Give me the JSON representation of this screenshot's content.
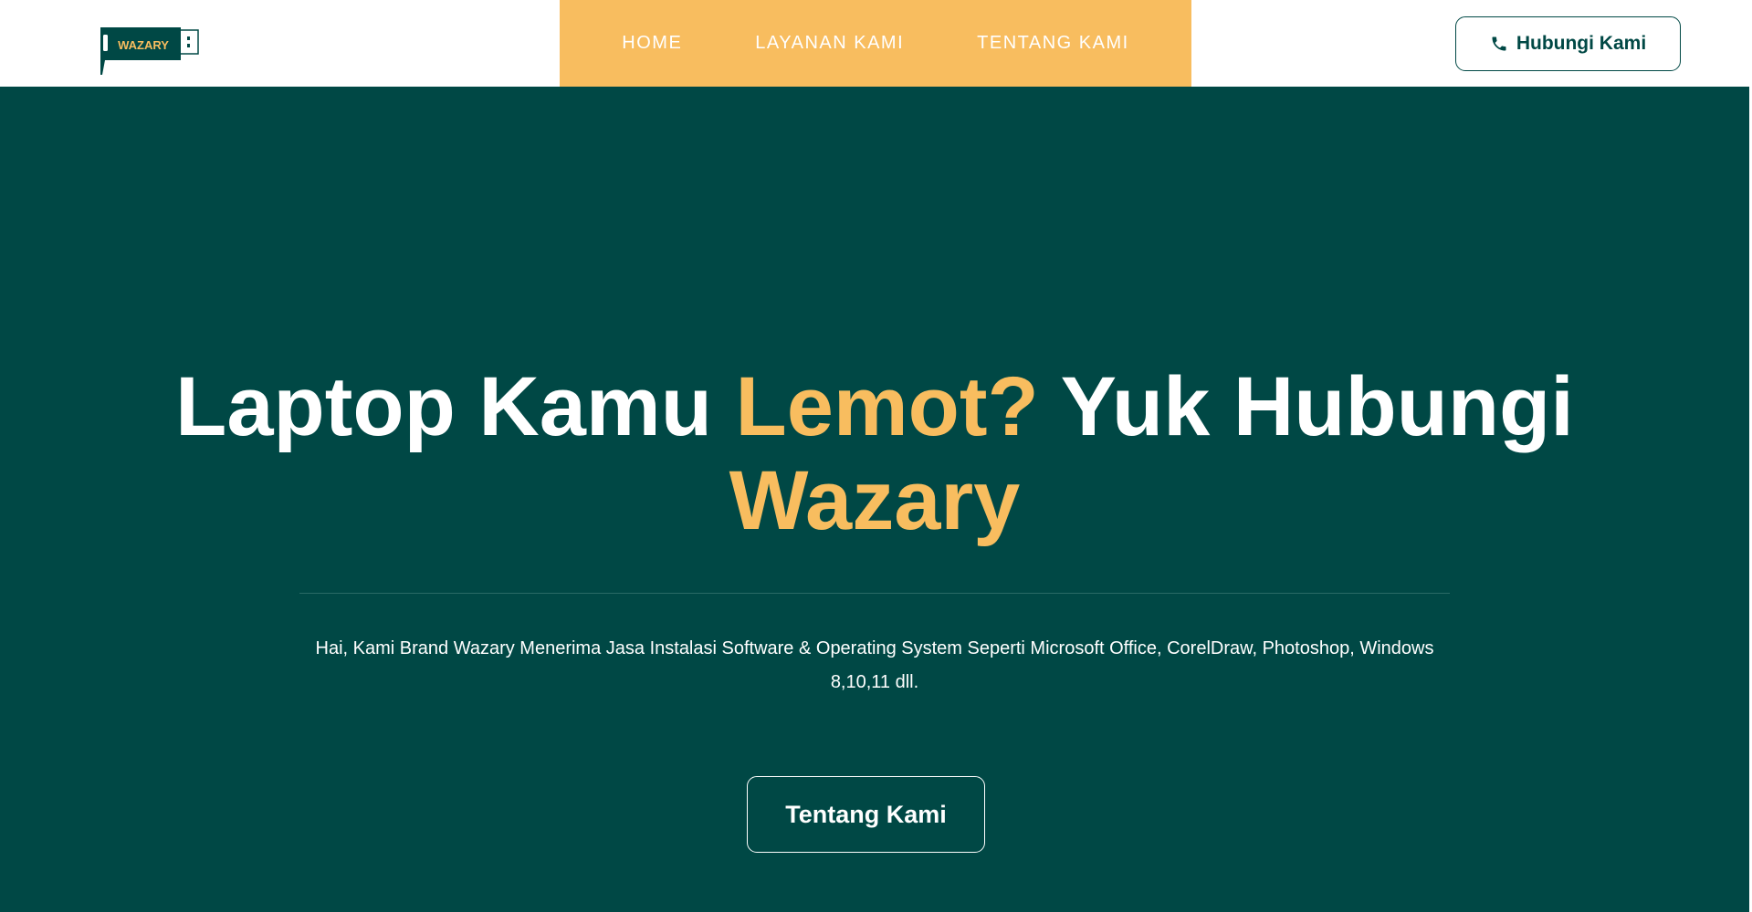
{
  "brand": {
    "logo_text": "WAZARY"
  },
  "nav": {
    "items": [
      {
        "label": "HOME"
      },
      {
        "label": "LAYANAN KAMI"
      },
      {
        "label": "TENTANG KAMI"
      }
    ]
  },
  "header": {
    "contact_label": "Hubungi Kami",
    "contact_icon": "phone-icon"
  },
  "hero": {
    "title_part1": "Laptop Kamu ",
    "title_accent1": "Lemot?",
    "title_part2": " Yuk Hubungi ",
    "title_accent2": "Wazary",
    "description": "Hai, Kami Brand Wazary Menerima Jasa Instalasi Software & Operating System Seperti Microsoft Office, CorelDraw, Photoshop, Windows 8,10,11 dll.",
    "button_label": "Tentang Kami"
  },
  "colors": {
    "primary": "#004845",
    "accent": "#f8bd5f",
    "white": "#ffffff"
  }
}
